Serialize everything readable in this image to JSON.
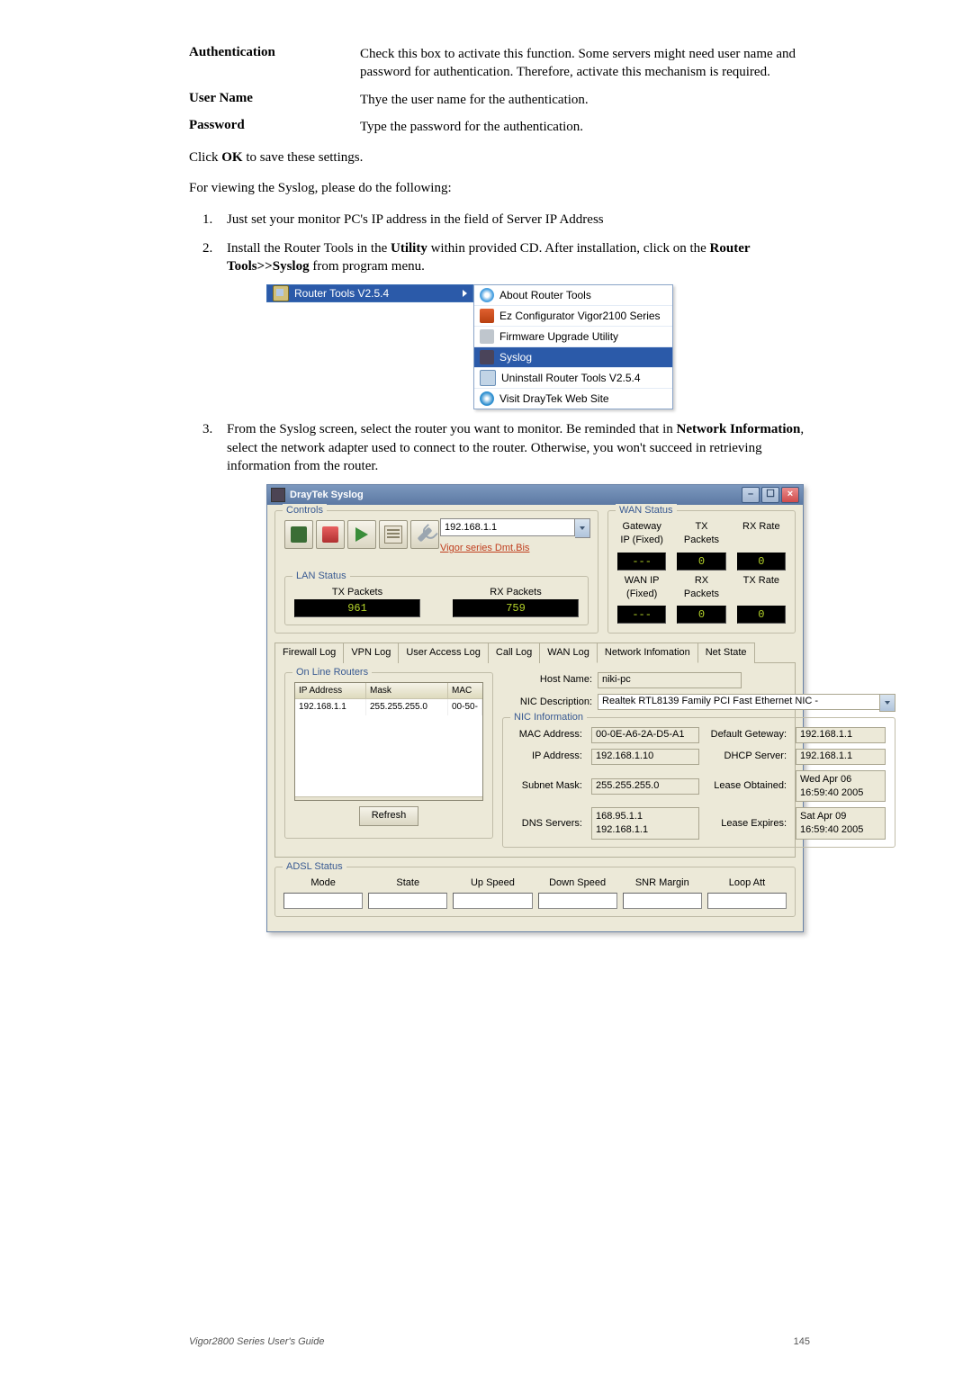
{
  "defs": {
    "auth": {
      "term": "Authentication",
      "desc": "Check this box to activate this function. Some servers might need user name and password for authentication. Therefore, activate this mechanism is required."
    },
    "user": {
      "term": "User Name",
      "desc": "Thye the user name for the authentication."
    },
    "pass": {
      "term": "Password",
      "desc": "Type the password for the authentication."
    }
  },
  "clickOk": {
    "pre": "Click ",
    "b": "OK",
    "post": " to save these settings."
  },
  "viewing": "For viewing the Syslog, please do the following:",
  "steps": {
    "s1": "Just set your monitor PC's IP address in the field of Server IP Address",
    "s2_pre": "Install the Router Tools in the ",
    "s2_b1": "Utility",
    "s2_mid": " within provided CD. After installation, click on the ",
    "s2_b2": "Router Tools>>Syslog",
    "s2_post": " from program menu.",
    "s3_pre": "From the Syslog screen, select the router you want to monitor. Be reminded that in ",
    "s3_b": "Network Information",
    "s3_post": ", select the network adapter used to connect to the router. Otherwise, you won't succeed in retrieving information from the router."
  },
  "menu": {
    "parent": "Router Tools V2.5.4",
    "items": {
      "about": "About Router Tools",
      "ez": "Ez Configurator Vigor2100 Series",
      "fw": "Firmware Upgrade Utility",
      "syslog": "Syslog",
      "uninstall": "Uninstall Router Tools V2.5.4",
      "visit": "Visit DrayTek Web Site"
    }
  },
  "win": {
    "title": "DrayTek Syslog",
    "controls": {
      "title": "Controls",
      "ip": "192.168.1.1",
      "link": "Vigor series Dmt.Bis"
    },
    "wan": {
      "title": "WAN Status",
      "gwLabel": "Gateway IP (Fixed)",
      "wanIpLabel": "WAN IP (Fixed)",
      "txLabel": "TX Packets",
      "rxLabel": "RX Packets",
      "rxRateLabel": "RX Rate",
      "txRateLabel": "TX Rate",
      "gw": "---",
      "tx": "0",
      "rxRate": "0",
      "wanIp": "---",
      "rx": "0",
      "txRate": "0"
    },
    "lan": {
      "title": "LAN Status",
      "txLabel": "TX Packets",
      "rxLabel": "RX Packets",
      "tx": "961",
      "rx": "759"
    },
    "tabs": {
      "fw": "Firewall Log",
      "vpn": "VPN Log",
      "ua": "User Access Log",
      "call": "Call Log",
      "wan": "WAN Log",
      "net": "Network Infomation",
      "state": "Net State"
    },
    "routers": {
      "title": "On Line Routers",
      "h_ip": "IP Address",
      "h_mask": "Mask",
      "h_mac": "MAC",
      "row": {
        "ip": "192.168.1.1",
        "mask": "255.255.255.0",
        "mac": "00-50-"
      },
      "refresh": "Refresh"
    },
    "nic": {
      "hostLabel": "Host Name:",
      "host": "niki-pc",
      "descLabel": "NIC Description:",
      "desc": "Realtek RTL8139 Family PCI Fast Ethernet NIC -",
      "infoTitle": "NIC Information",
      "macLabel": "MAC Address:",
      "mac": "00-0E-A6-2A-D5-A1",
      "ipLabel": "IP Address:",
      "ip": "192.168.1.10",
      "maskLabel": "Subnet Mask:",
      "mask": "255.255.255.0",
      "dnsLabel": "DNS Servers:",
      "dns1": "168.95.1.1",
      "dns2": "192.168.1.1",
      "gwLabel": "Default Geteway:",
      "gw": "192.168.1.1",
      "dhcpLabel": "DHCP Server:",
      "dhcp": "192.168.1.1",
      "obtLabel": "Lease Obtained:",
      "obt1": "Wed Apr 06",
      "obt2": "16:59:40 2005",
      "expLabel": "Lease Expires:",
      "exp1": "Sat Apr 09",
      "exp2": "16:59:40 2005"
    },
    "adsl": {
      "title": "ADSL Status",
      "mode": "Mode",
      "state": "State",
      "up": "Up Speed",
      "down": "Down Speed",
      "snr": "SNR Margin",
      "loop": "Loop Att"
    }
  },
  "footer": {
    "guide": "Vigor2800 Series User's Guide",
    "page": "145"
  }
}
